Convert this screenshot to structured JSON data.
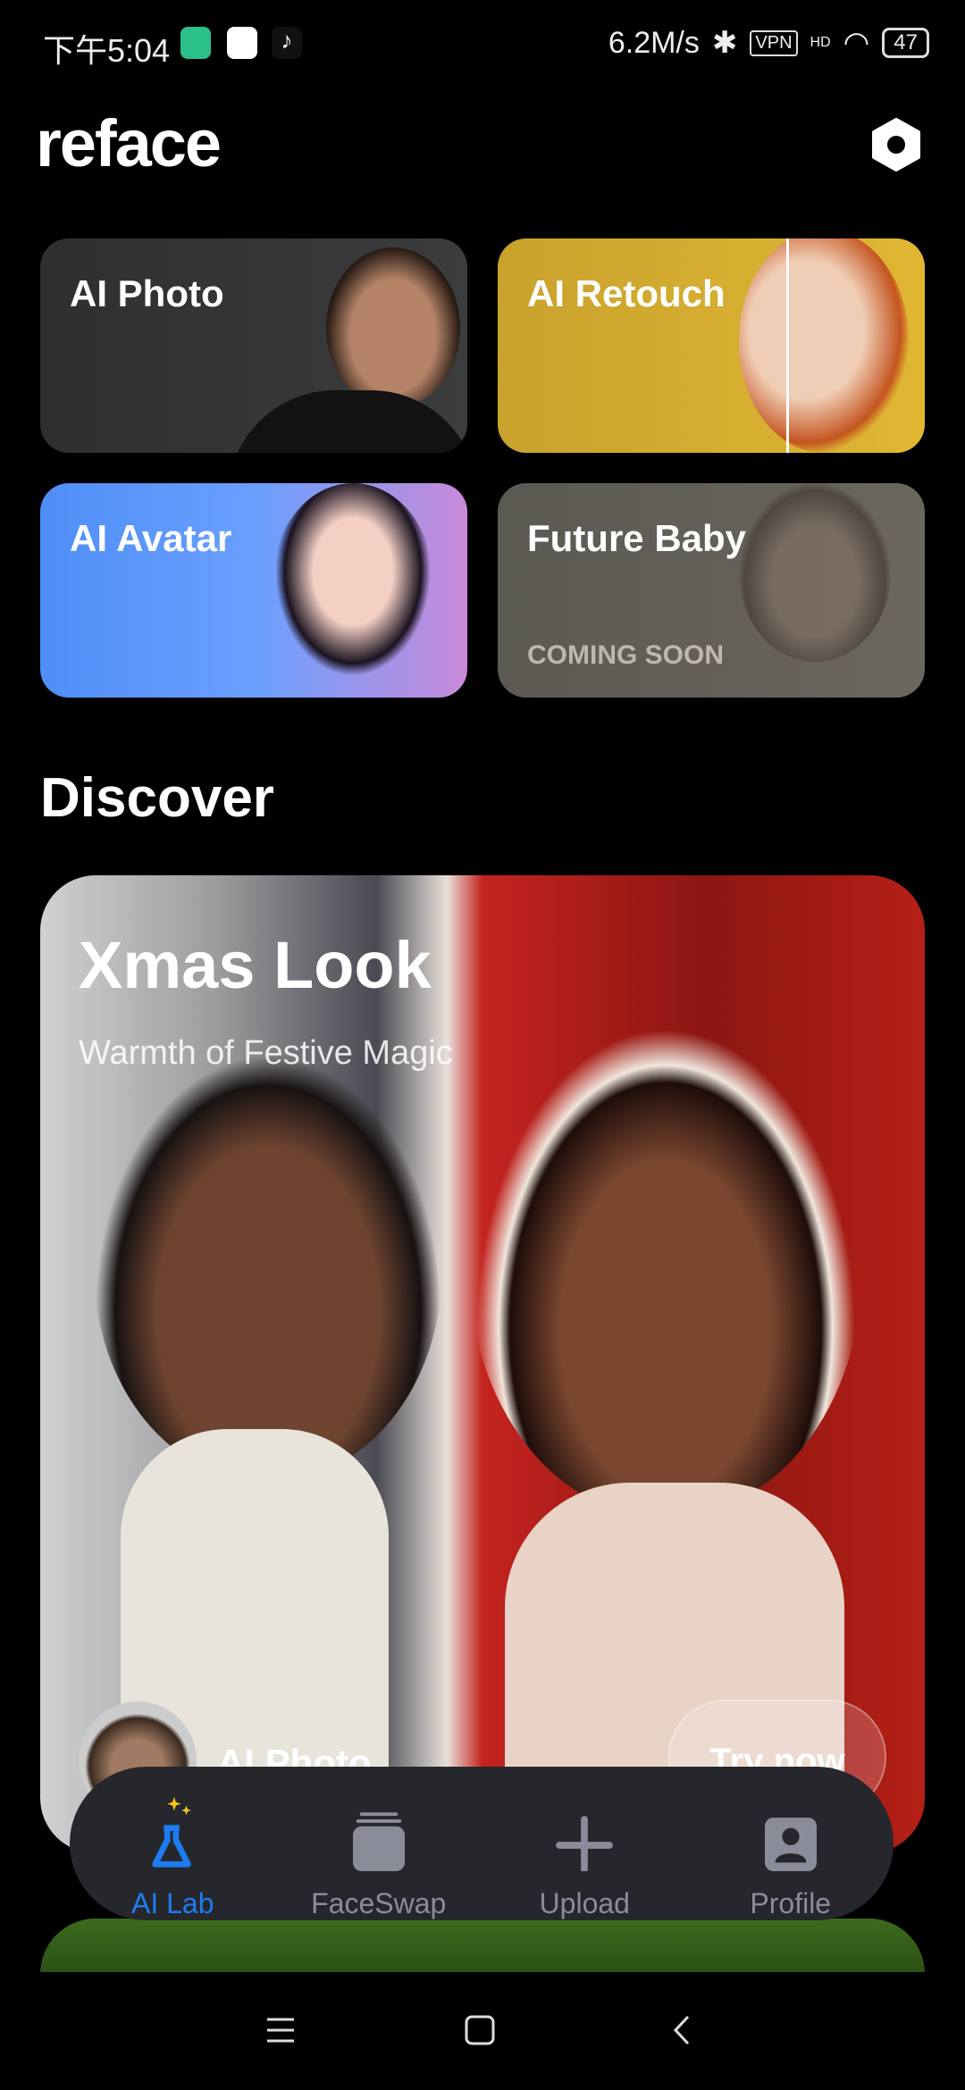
{
  "status_bar": {
    "time": "下午5:04",
    "speed": "6.2M/s",
    "vpn": "VPN",
    "network": "HD",
    "battery": "47"
  },
  "header": {
    "logo": "reface",
    "settings_icon": "hexagon-settings-icon"
  },
  "tools": [
    {
      "label": "AI Photo"
    },
    {
      "label": "AI Retouch"
    },
    {
      "label": "AI Avatar"
    },
    {
      "label": "Future Baby",
      "badge": "COMING SOON"
    }
  ],
  "discover": {
    "heading": "Discover",
    "featured": {
      "title": "Xmas Look",
      "subtitle": "Warmth of Festive Magic",
      "feature_label": "AI Photo",
      "cta": "Try now"
    }
  },
  "bottom_nav": {
    "items": [
      {
        "label": "AI Lab",
        "icon": "flask-sparkle-icon",
        "active": true
      },
      {
        "label": "FaceSwap",
        "icon": "card-stack-icon"
      },
      {
        "label": "Upload",
        "icon": "plus-icon"
      },
      {
        "label": "Profile",
        "icon": "profile-icon"
      }
    ],
    "active_color": "#1e7cf0",
    "inactive_color": "#8a8d99"
  }
}
